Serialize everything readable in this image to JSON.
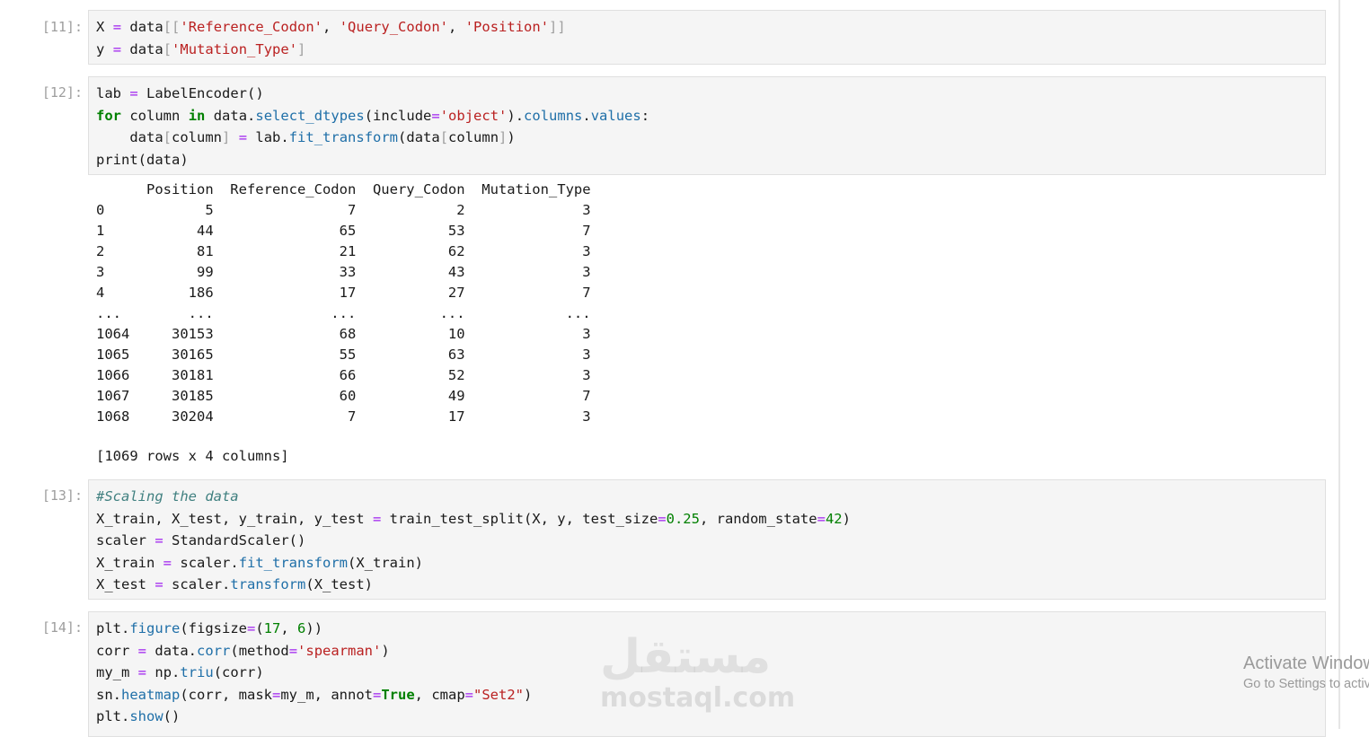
{
  "cells": {
    "c11": {
      "prompt": "[11]:",
      "line1": {
        "v": "X",
        "eq": "=",
        "data": "data",
        "ob": "[[",
        "s1": "'Reference_Codon'",
        "c1": ",",
        "s2": "'Query_Codon'",
        "c2": ",",
        "s3": "'Position'",
        "cb": "]]"
      },
      "line2": {
        "v": "y",
        "eq": "=",
        "data": "data",
        "ob": "[",
        "s1": "'Mutation_Type'",
        "cb": "]"
      }
    },
    "c12": {
      "prompt": "[12]:",
      "line1": {
        "v": "lab",
        "eq": "=",
        "call": "LabelEncoder()"
      },
      "line2": {
        "kw_for": "for",
        "var": "column",
        "kw_in": "in",
        "obj": "data.",
        "meth": "select_dtypes",
        "p1": "(include",
        "eq": "=",
        "s": "'object'",
        "p2": ").",
        "a1": "columns",
        "dot": ".",
        "a2": "values",
        "colon": ":"
      },
      "line3": {
        "indent": "    ",
        "d1": "data",
        "b1": "[",
        "v1": "column",
        "b2": "]",
        "eq": "=",
        "obj": "lab.",
        "meth": "fit_transform",
        "p1": "(data",
        "b3": "[",
        "v2": "column",
        "b4": "]",
        "p2": ")"
      },
      "line4": {
        "text": "print(data)"
      }
    },
    "output12": {
      "table": "      Position  Reference_Codon  Query_Codon  Mutation_Type\n0            5                7            2              3\n1           44               65           53              7\n2           81               21           62              3\n3           99               33           43              3\n4          186               17           27              7\n...        ...              ...          ...            ...\n1064     30153               68           10              3\n1065     30165               55           63              3\n1066     30181               66           52              3\n1067     30185               60           49              7\n1068     30204                7           17              3",
      "summary": "[1069 rows x 4 columns]"
    },
    "c13": {
      "prompt": "[13]:",
      "line1": {
        "comment": "#Scaling the data"
      },
      "line2": {
        "lhs": "X_train, X_test, y_train, y_test",
        "eq": "=",
        "fn": "train_test_split(X, y, test_size",
        "eq2": "=",
        "n1": "0.25",
        "mid": ", random_state",
        "eq3": "=",
        "n2": "42",
        "end": ")"
      },
      "line3": {
        "v": "scaler",
        "eq": "=",
        "call": "StandardScaler()"
      },
      "line4": {
        "v": "X_train",
        "eq": "=",
        "obj": "scaler.",
        "meth": "fit_transform",
        "args": "(X_train)"
      },
      "line5": {
        "v": "X_test",
        "eq": "=",
        "obj": "scaler.",
        "meth": "transform",
        "args": "(X_test)"
      }
    },
    "c14": {
      "prompt": "[14]:",
      "line1": {
        "obj": "plt.",
        "meth": "figure",
        "p1": "(figsize",
        "eq": "=",
        "p2": "(",
        "n1": "17",
        "c": ", ",
        "n2": "6",
        "p3": "))"
      },
      "line2": {
        "v": "corr",
        "eq": "=",
        "obj": "data.",
        "meth": "corr",
        "p1": "(method",
        "eq2": "=",
        "s": "'spearman'",
        "p2": ")"
      },
      "line3": {
        "v": "my_m",
        "eq": "=",
        "obj": "np.",
        "meth": "triu",
        "args": "(corr)"
      },
      "line4": {
        "obj": "sn.",
        "meth": "heatmap",
        "p1": "(corr, mask",
        "eq": "=",
        "p2": "my_m, annot",
        "eq2": "=",
        "kw": "True",
        "p3": ", cmap",
        "eq3": "=",
        "s": "\"Set2\"",
        "p4": ")"
      },
      "line5": {
        "obj": "plt.",
        "meth": "show",
        "args": "()"
      }
    }
  },
  "watermark": {
    "logo": "مستقل",
    "text": "mostaql.com"
  },
  "activation": {
    "title": "Activate Windows",
    "subtitle": "Go to Settings to activate Windows."
  },
  "colors": {
    "keyword": "#008000",
    "operator": "#a020f0",
    "string": "#ba2121",
    "number": "#008000",
    "attribute": "#1f6fa8",
    "comment": "#408080",
    "cell_bg": "#f5f5f5",
    "prompt": "#9e9e9e"
  }
}
